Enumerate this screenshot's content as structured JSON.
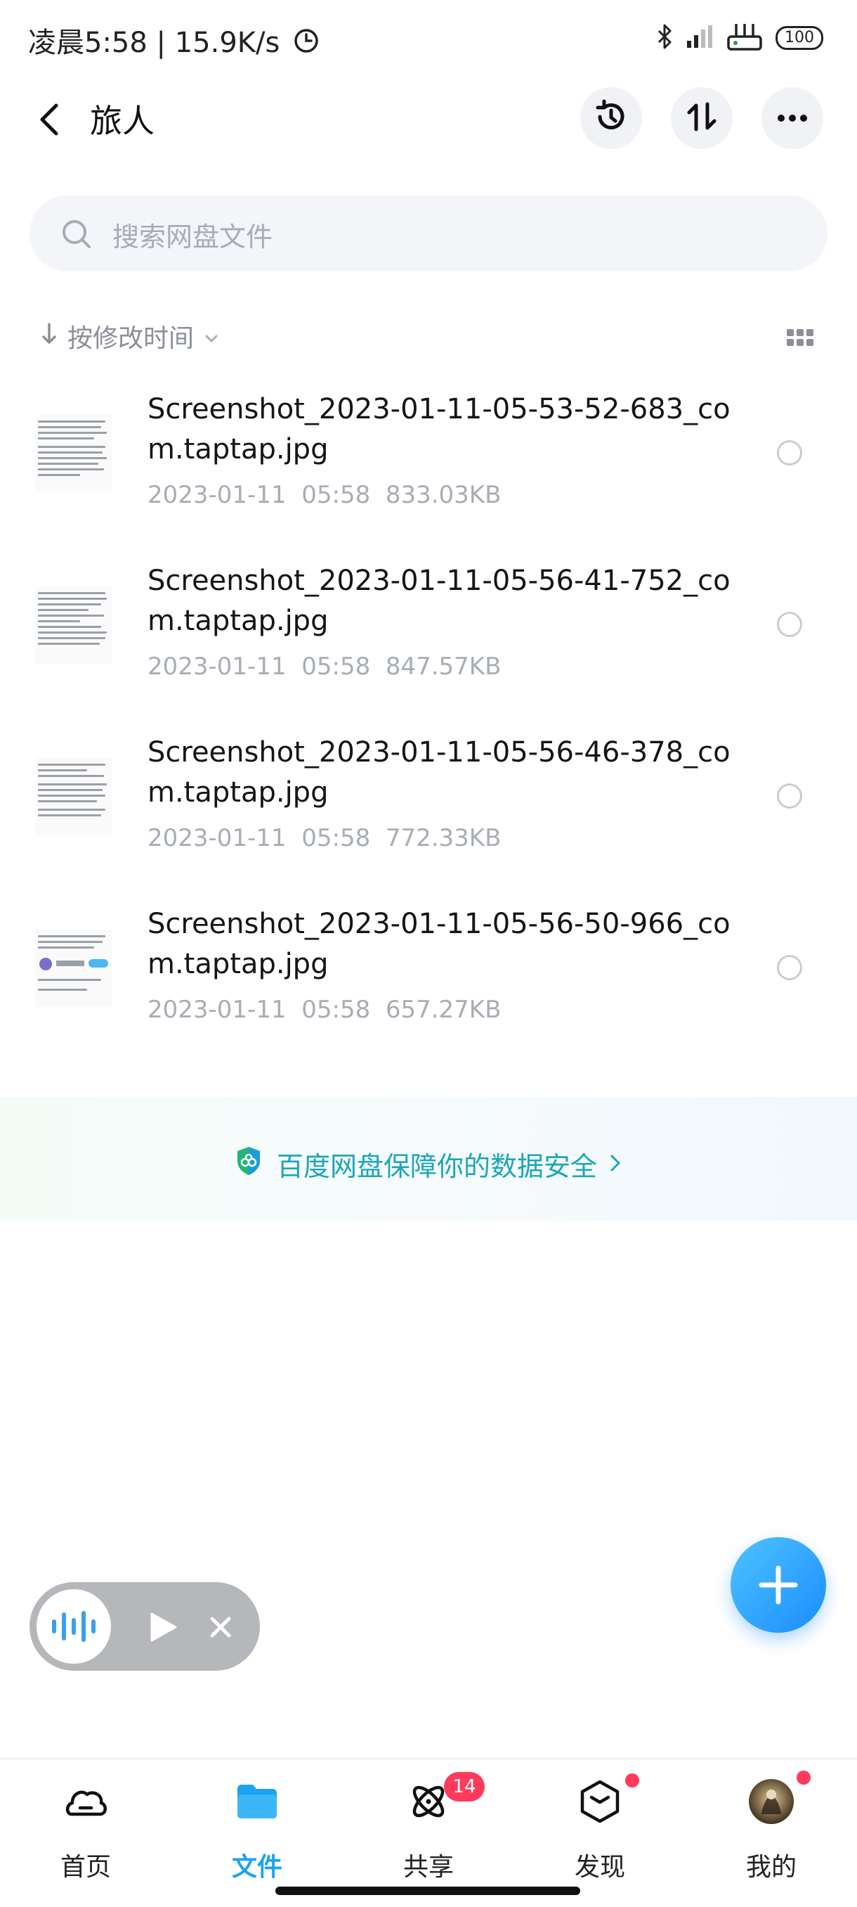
{
  "status_bar": {
    "time_text": "凌晨5:58 | 15.9K/s",
    "battery": "100",
    "icons": [
      "alarm-icon",
      "bluetooth-icon",
      "signal-icon",
      "router-icon",
      "battery-icon"
    ]
  },
  "header": {
    "title": "旅人",
    "icons": [
      "back-icon",
      "history-icon",
      "transfer-icon",
      "more-icon"
    ]
  },
  "search": {
    "placeholder": "搜索网盘文件"
  },
  "sort": {
    "label": "按修改时间"
  },
  "files": [
    {
      "name": "Screenshot_2023-01-11-05-53-52-683_com.taptap.jpg",
      "date": "2023-01-11",
      "time": "05:58",
      "size": "833.03KB"
    },
    {
      "name": "Screenshot_2023-01-11-05-56-41-752_com.taptap.jpg",
      "date": "2023-01-11",
      "time": "05:58",
      "size": "847.57KB"
    },
    {
      "name": "Screenshot_2023-01-11-05-56-46-378_com.taptap.jpg",
      "date": "2023-01-11",
      "time": "05:58",
      "size": "772.33KB"
    },
    {
      "name": "Screenshot_2023-01-11-05-56-50-966_com.taptap.jpg",
      "date": "2023-01-11",
      "time": "05:58",
      "size": "657.27KB"
    }
  ],
  "banner": {
    "text": "百度网盘保障你的数据安全"
  },
  "nav": {
    "items": [
      {
        "label": "首页",
        "icon": "home-icon"
      },
      {
        "label": "文件",
        "icon": "folder-icon",
        "active": true
      },
      {
        "label": "共享",
        "icon": "share-icon",
        "badge": "14"
      },
      {
        "label": "发现",
        "icon": "discover-icon"
      },
      {
        "label": "我的",
        "icon": "avatar"
      }
    ]
  },
  "colors": {
    "accent": "#1a8cff",
    "active_nav": "#1aa3f0",
    "badge": "#ff3b5c",
    "banner_text": "#1aa7b9"
  }
}
